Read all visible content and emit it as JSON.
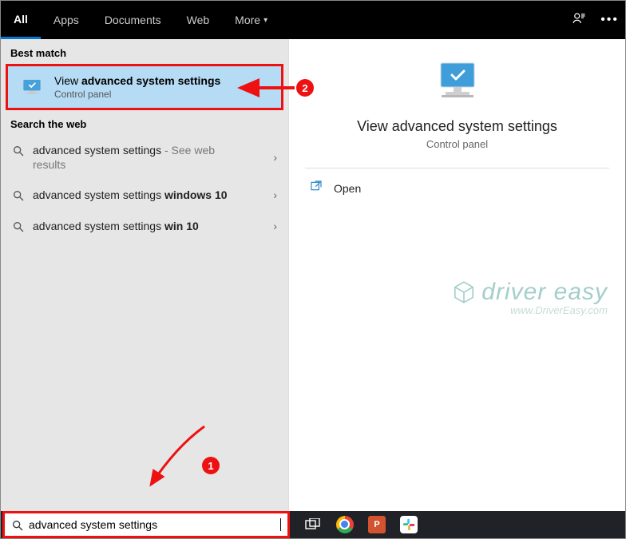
{
  "topbar": {
    "tabs": [
      "All",
      "Apps",
      "Documents",
      "Web",
      "More"
    ],
    "active": 0
  },
  "left": {
    "best_match_header": "Best match",
    "best_match": {
      "title_prefix": "View ",
      "title_bold": "advanced system settings",
      "sub": "Control panel"
    },
    "search_web_header": "Search the web",
    "web_items": [
      {
        "plain": "advanced system settings",
        "grey": " - See web results",
        "bold": ""
      },
      {
        "plain": "advanced system settings ",
        "grey": "",
        "bold": "windows 10"
      },
      {
        "plain": "advanced system settings ",
        "grey": "",
        "bold": "win 10"
      }
    ]
  },
  "right": {
    "title": "View advanced system settings",
    "sub": "Control panel",
    "open_label": "Open"
  },
  "watermark": {
    "brand": "driver easy",
    "url": "www.DriverEasy.com"
  },
  "searchbox": {
    "value": "advanced system settings"
  },
  "annotations": {
    "step1": "1",
    "step2": "2"
  }
}
